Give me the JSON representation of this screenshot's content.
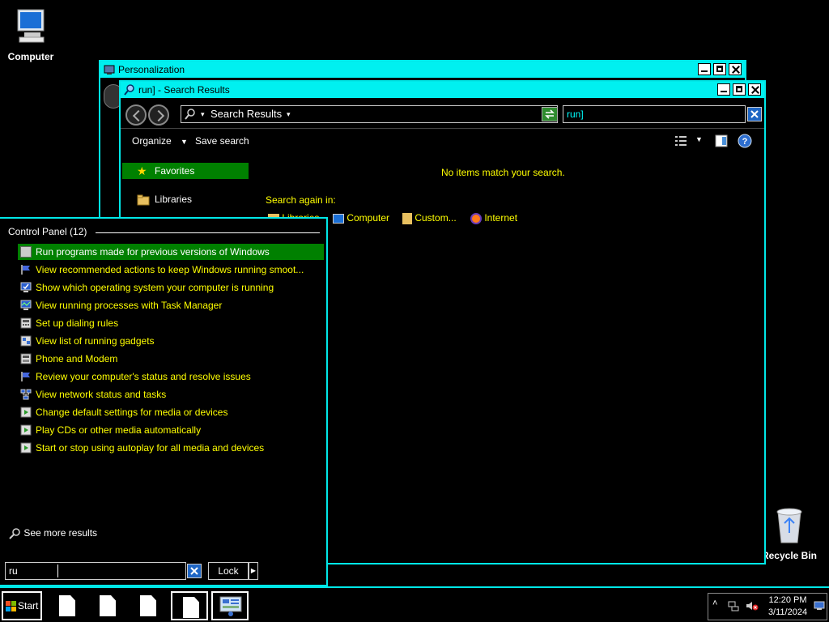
{
  "desktop": {
    "computer_label": "Computer",
    "recycle_label": "Recycle Bin"
  },
  "personalization_window": {
    "title": "Personalization"
  },
  "search_window": {
    "title": "run] - Search Results",
    "address_text": "Search Results",
    "search_value": "run]",
    "organize_label": "Organize",
    "save_search_label": "Save search",
    "favorites_label": "Favorites",
    "libraries_label": "Libraries",
    "no_items_text": "No items match your search.",
    "search_again_label": "Search again in:",
    "locations": [
      "Libraries",
      "Computer",
      "Custom...",
      "Internet"
    ]
  },
  "start_search": {
    "group_header": "Control Panel (12)",
    "results": [
      "Run programs made for previous versions of Windows",
      "View recommended actions to keep Windows running smoot...",
      "Show which operating system your computer is running",
      "View running processes with Task Manager",
      "Set up dialing rules",
      "View list of running gadgets",
      "Phone and Modem",
      "Review your computer's status and resolve issues",
      "View network status and tasks",
      "Change default settings for media or devices",
      "Play CDs or other media automatically",
      "Start or stop using autoplay for all media and devices"
    ],
    "see_more_label": "See more results",
    "query_value": "ru",
    "lock_label": "Lock"
  },
  "taskbar": {
    "start_label": "Start",
    "time": "12:20 PM",
    "date": "3/11/2024"
  },
  "colors": {
    "accent": "#00f0f0",
    "highlight": "#008000",
    "result_text": "#ffff00"
  }
}
